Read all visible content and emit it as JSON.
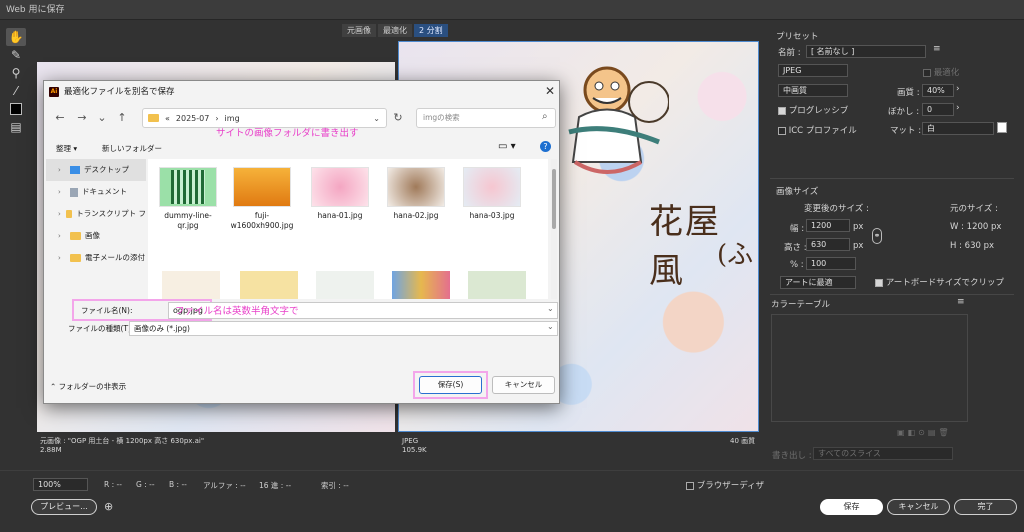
{
  "window": {
    "title": "Web 用に保存"
  },
  "view_tabs": [
    "元画像",
    "最適化",
    "2 分割"
  ],
  "view_tab_active": 2,
  "preview_right": {
    "title_text": "花屋 風",
    "subtitle_text": "(ふ"
  },
  "panes": {
    "left_info_line1": "元画像 : \"OGP 用土台 - 横 1200px 高さ 630px.ai\"",
    "left_info_line2": "2.88M",
    "right_info_line1": "JPEG",
    "right_info_line2": "105.9K",
    "right_info_quality": "40 画質"
  },
  "dialog": {
    "title": "最適化ファイルを別名で保存",
    "ai_badge": "Ai",
    "path": [
      "«",
      "2025-07",
      "›",
      "img"
    ],
    "search_placeholder": "imgの検索",
    "annotation_folder": "サイトの画像フォルダに書き出す",
    "toolbar": {
      "organize": "整理 ▾",
      "new_folder": "新しいフォルダー"
    },
    "tree": [
      {
        "label": "デスクトップ",
        "selected": true
      },
      {
        "label": "ドキュメント",
        "selected": false
      },
      {
        "label": "トランスクリプト フ",
        "selected": false
      },
      {
        "label": "画像",
        "selected": false
      },
      {
        "label": "電子メールの添付",
        "selected": false
      }
    ],
    "files": [
      {
        "name": "dummy-line-qr.jpg"
      },
      {
        "name": "fuji-w1600xh900.jpg"
      },
      {
        "name": "hana-01.jpg"
      },
      {
        "name": "hana-02.jpg"
      },
      {
        "name": "hana-03.jpg"
      }
    ],
    "filename_label": "ファイル名(N):",
    "filename_value": "ogp.jpg",
    "annotation_filename": "ファイル名は英数半角文字で",
    "filetype_label": "ファイルの種類(T):",
    "filetype_value": "画像のみ (*.jpg)",
    "hide_folders": "フォルダーの非表示",
    "save_label": "保存(S)",
    "cancel_label": "キャンセル"
  },
  "panel": {
    "preset_title": "プリセット",
    "name_label": "名前 :",
    "name_value": "[ 名前なし ]",
    "format_value": "JPEG",
    "optimize_label": "最適化",
    "quality_preset": "中画質",
    "quality_label": "画質 :",
    "quality_value": "40%",
    "progressive_label": "プログレッシブ",
    "blur_label": "ぼかし :",
    "blur_value": "0",
    "icc_label": "ICC プロファイル",
    "matte_label": "マット :",
    "matte_value": "白",
    "image_size_title": "画像サイズ",
    "new_size_label": "変更後のサイズ :",
    "orig_size_label": "元のサイズ :",
    "width_label": "幅 :",
    "width_value": "1200",
    "height_label": "高さ :",
    "height_value": "630",
    "percent_label": "% :",
    "percent_value": "100",
    "unit": "px",
    "orig_w": "W : 1200 px",
    "orig_h": "H : 630 px",
    "art_select": "アートに最適",
    "artboard_clip": "アートボードサイズでクリップ",
    "color_table_title": "カラーテーブル",
    "export_label": "書き出し :",
    "export_value": "すべてのスライス"
  },
  "bottom": {
    "zoom": "100%",
    "r": "R : --",
    "g": "G : --",
    "b": "B : --",
    "alpha": "アルファ : --",
    "hex": "16 進 : --",
    "index": "索引 : --",
    "browser_dither": "ブラウザーディザ",
    "preview_btn": "プレビュー...",
    "save_btn": "保存",
    "cancel_btn": "キャンセル",
    "done_btn": "完了"
  }
}
